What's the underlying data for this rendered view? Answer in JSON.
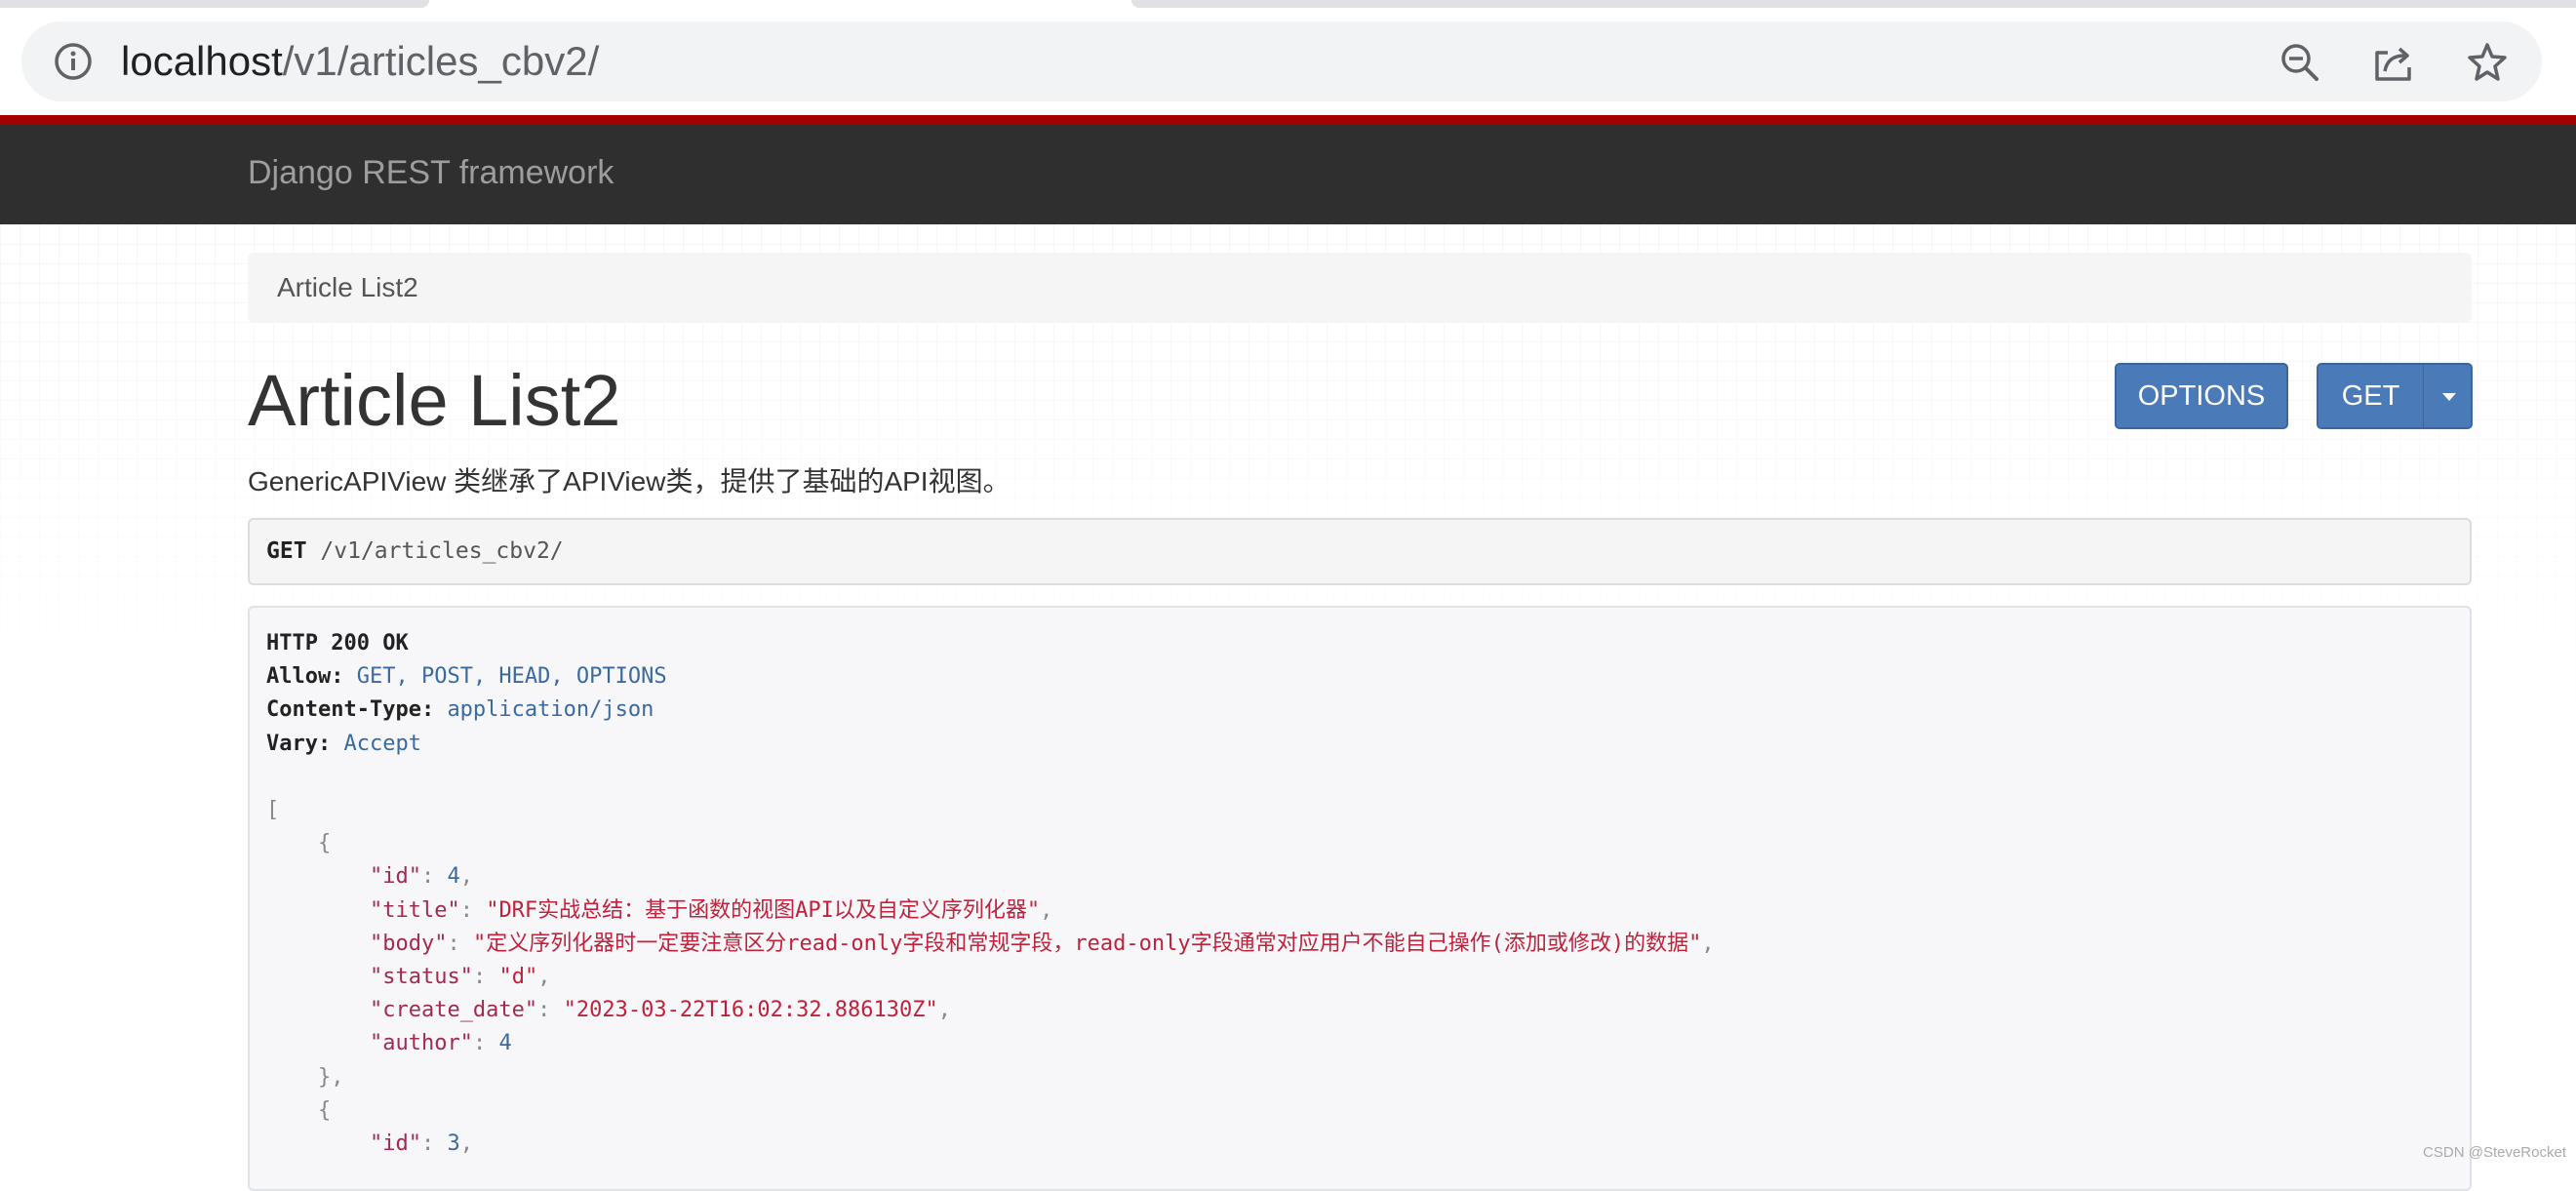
{
  "browser": {
    "url_host": "localhost",
    "url_path": "/v1/articles_cbv2/",
    "icons": [
      "info-icon",
      "zoom-out-icon",
      "share-icon",
      "bookmark-star-icon"
    ]
  },
  "navbar": {
    "brand": "Django REST framework"
  },
  "breadcrumb": {
    "current": "Article List2"
  },
  "page": {
    "title": "Article List2",
    "description": "GenericAPIView 类继承了APIView类，提供了基础的API视图。"
  },
  "buttons": {
    "options": "OPTIONS",
    "get": "GET",
    "caret_icon": "caret-down-icon"
  },
  "request": {
    "method": "GET",
    "path": "/v1/articles_cbv2/"
  },
  "response": {
    "status": "HTTP 200 OK",
    "headers": [
      {
        "name": "Allow:",
        "value": "GET, POST, HEAD, OPTIONS"
      },
      {
        "name": "Content-Type:",
        "value": "application/json"
      },
      {
        "name": "Vary:",
        "value": "Accept"
      }
    ],
    "items": [
      {
        "id": 4,
        "title": "DRF实战总结：基于函数的视图API以及自定义序列化器",
        "body": "定义序列化器时一定要注意区分read-only字段和常规字段，read-only字段通常对应用户不能自己操作(添加或修改)的数据",
        "status": "d",
        "create_date": "2023-03-22T16:02:32.886130Z",
        "author": 4
      },
      {
        "id": 3
      }
    ]
  },
  "watermark": "CSDN @SteveRocket",
  "colors": {
    "navbar": "#2f2f2f",
    "accent_line": "#a30000",
    "button": "#4a7ab8",
    "json_string": "#c0223b",
    "json_number": "#3b6aa0"
  }
}
